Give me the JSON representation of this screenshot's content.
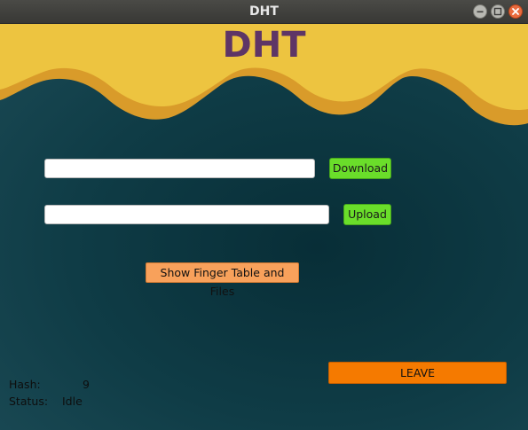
{
  "window": {
    "title": "DHT"
  },
  "header": {
    "title": "DHT"
  },
  "download": {
    "input_value": "",
    "button_label": "Download"
  },
  "upload": {
    "input_value": "",
    "button_label": "Upload"
  },
  "actions": {
    "finger_table_label": "Show Finger Table and Files",
    "leave_label": "LEAVE"
  },
  "status": {
    "hash_label": "Hash:",
    "hash_value": "9",
    "status_label": "Status:",
    "status_value": "Idle"
  },
  "colors": {
    "title_text": "#5e3566",
    "wave_yellow": "#edc440",
    "wave_shadow": "#d99b2a",
    "background": "#0f3c46",
    "green_button": "#6ade2a",
    "orange_button": "#f8a15b",
    "leave_button": "#f57a00"
  }
}
